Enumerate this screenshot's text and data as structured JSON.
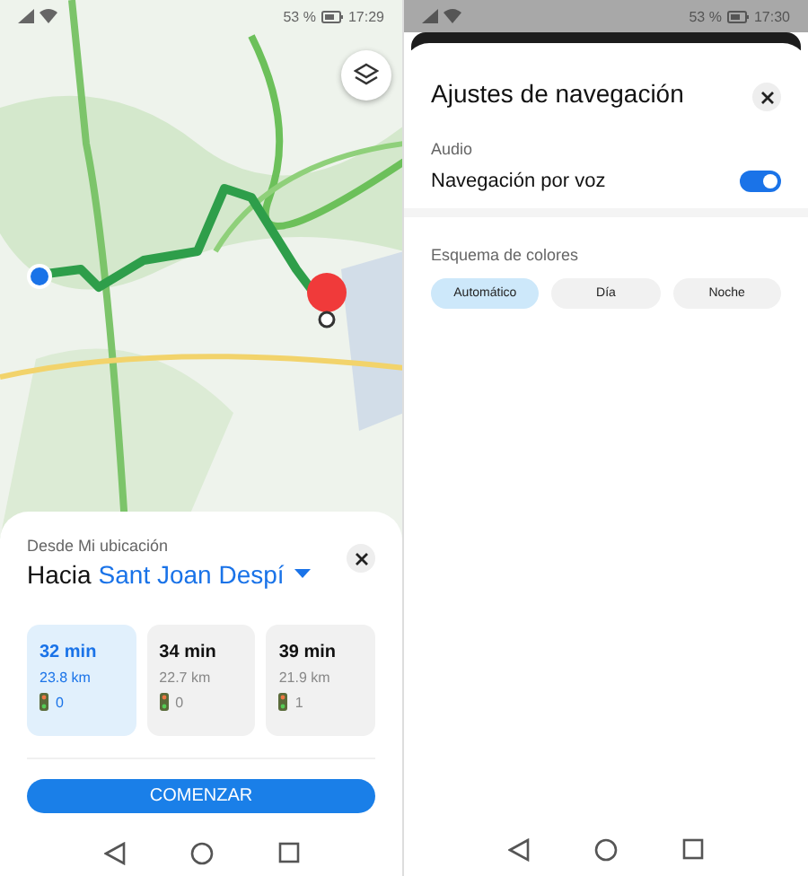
{
  "route_screen": {
    "status_bar": {
      "battery": "53 %",
      "time": "17:29"
    },
    "route_sheet": {
      "origin": "Desde Mi ubicación",
      "destination_prefix": "Hacia",
      "destination": "Sant Joan Despí",
      "routes": [
        {
          "duration": "32 min",
          "distance": "23.8 km",
          "traffic_lights": "0",
          "selected": true
        },
        {
          "duration": "34 min",
          "distance": "22.7 km",
          "traffic_lights": "0",
          "selected": false
        },
        {
          "duration": "39 min",
          "distance": "21.9 km",
          "traffic_lights": "1",
          "selected": false
        }
      ],
      "start_button": "COMENZAR"
    }
  },
  "settings_screen": {
    "status_bar": {
      "battery": "53 %",
      "time": "17:30"
    },
    "title": "Ajustes de navegación",
    "sections": [
      {
        "heading": "Audio",
        "kind": "toggles",
        "items": [
          {
            "label": "Navegación por voz",
            "on": true
          }
        ]
      },
      {
        "heading": "Esquema de colores",
        "kind": "chips",
        "items": [
          {
            "label": "Automático",
            "selected": true
          },
          {
            "label": "Día",
            "selected": false
          },
          {
            "label": "Noche",
            "selected": false
          }
        ]
      }
    ]
  }
}
